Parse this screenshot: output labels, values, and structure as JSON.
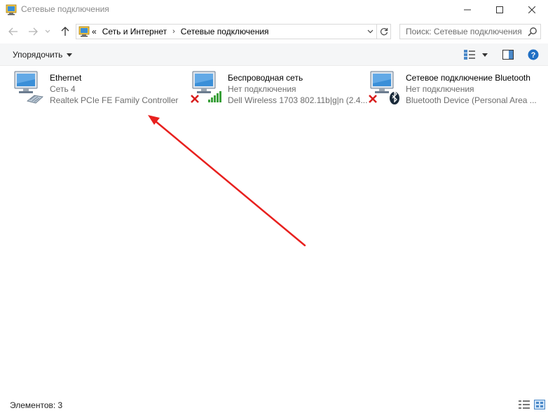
{
  "window": {
    "title": "Сетевые подключения"
  },
  "address": {
    "overflow": "«",
    "crumbs": [
      "Сеть и Интернет",
      "Сетевые подключения"
    ]
  },
  "search": {
    "placeholder": "Поиск: Сетевые подключения"
  },
  "toolbar": {
    "organize_label": "Упорядочить"
  },
  "connections": [
    {
      "name": "Ethernet",
      "status": "Сеть  4",
      "device": "Realtek PCIe FE Family Controller",
      "icon": "ethernet-cable-icon",
      "disconnected": false
    },
    {
      "name": "Беспроводная сеть",
      "status": "Нет подключения",
      "device": "Dell Wireless 1703 802.11b|g|n (2.4...",
      "icon": "wifi-signal-icon",
      "disconnected": true
    },
    {
      "name": "Сетевое подключение Bluetooth",
      "status": "Нет подключения",
      "device": "Bluetooth Device (Personal Area ...",
      "icon": "bluetooth-icon",
      "disconnected": true
    }
  ],
  "statusbar": {
    "count_label": "Элементов: 3"
  },
  "colors": {
    "accent_arrow": "#e8201e",
    "muted_text": "#6d6d6d",
    "error_x": "#d81e1e",
    "monitor_blue": "#3a8fd8"
  }
}
